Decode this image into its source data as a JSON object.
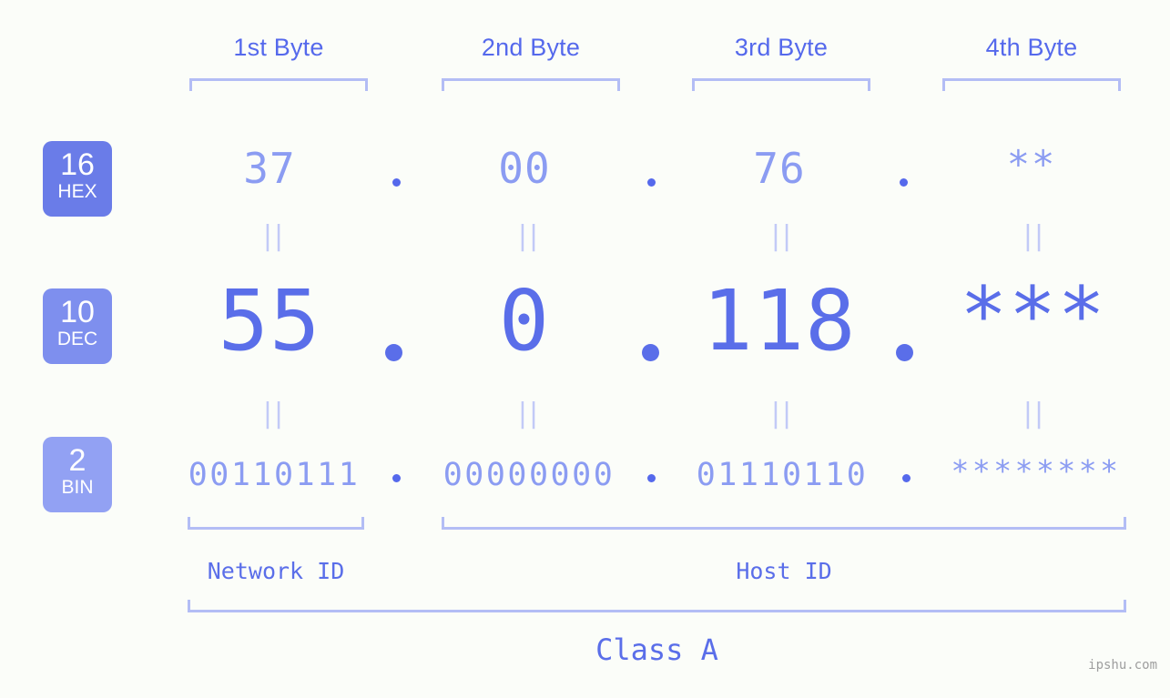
{
  "colors": {
    "background": "#fbfdf9",
    "accent_strong": "#5569ec",
    "accent_dec": "#5a6ee9",
    "accent_light": "#8b9cf2",
    "bracket": "#b3bdf5",
    "equals": "#c2caf7",
    "badge_hex": "#6a7ce8",
    "badge_dec": "#7e8fee",
    "badge_bin": "#92a1f3",
    "watermark": "#9e9e9e"
  },
  "byte_headers": [
    {
      "label": "1st Byte"
    },
    {
      "label": "2nd Byte"
    },
    {
      "label": "3rd Byte"
    },
    {
      "label": "4th Byte"
    }
  ],
  "bases": [
    {
      "number": "16",
      "abbr": "HEX"
    },
    {
      "number": "10",
      "abbr": "DEC"
    },
    {
      "number": "2",
      "abbr": "BIN"
    }
  ],
  "rows": {
    "hex": {
      "base_number": "16",
      "base_abbr": "HEX",
      "values": [
        "37",
        "00",
        "76",
        "**"
      ],
      "separator": "."
    },
    "dec": {
      "base_number": "10",
      "base_abbr": "DEC",
      "values": [
        "55",
        "0",
        "118",
        "***"
      ],
      "separator": "."
    },
    "bin": {
      "base_number": "2",
      "base_abbr": "BIN",
      "values": [
        "00110111",
        "00000000",
        "01110110",
        "********"
      ],
      "separator": "."
    }
  },
  "equals_glyph": "||",
  "sections": {
    "network_id": "Network ID",
    "host_id": "Host ID",
    "class": "Class A"
  },
  "watermark": "ipshu.com"
}
